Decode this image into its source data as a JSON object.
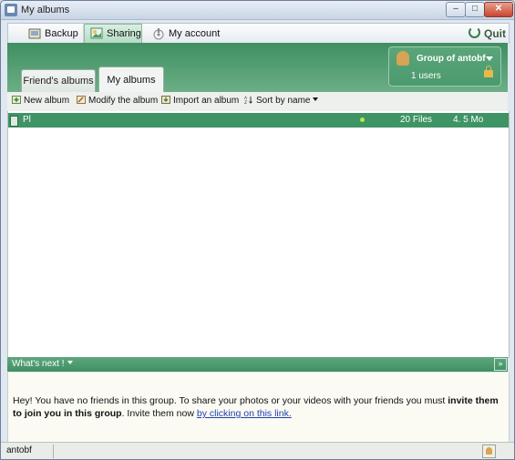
{
  "window": {
    "title": "My albums"
  },
  "top_tabs": [
    {
      "label": "Backup",
      "icon": "backup-icon"
    },
    {
      "label": "Sharing",
      "icon": "sharing-icon",
      "active": true
    },
    {
      "label": "My account",
      "icon": "account-icon"
    }
  ],
  "quit_label": "Quit",
  "group": {
    "name": "Group of antobf",
    "users": "1 users"
  },
  "sub_tabs": [
    {
      "label": "Friend's albums"
    },
    {
      "label": "My albums",
      "active": true
    }
  ],
  "toolbar": {
    "new_album": "New album",
    "modify_album": "Modify the album",
    "import_album": "Import an album",
    "sort": "Sort by name"
  },
  "albums": [
    {
      "name": "Pl",
      "files": "20 Files",
      "size": "4. 5 Mo"
    }
  ],
  "whats_next": "What's next !",
  "message": {
    "text1": "Hey! You have no friends in this group. To share your photos or your videos with your friends you must ",
    "bold": "invite them to join you in this group",
    "text2": ". Invite them now ",
    "link": "by clicking on this link."
  },
  "status": {
    "user": "antobf"
  },
  "colors": {
    "accent_green": "#3e9464",
    "link": "#1f3fb0"
  }
}
